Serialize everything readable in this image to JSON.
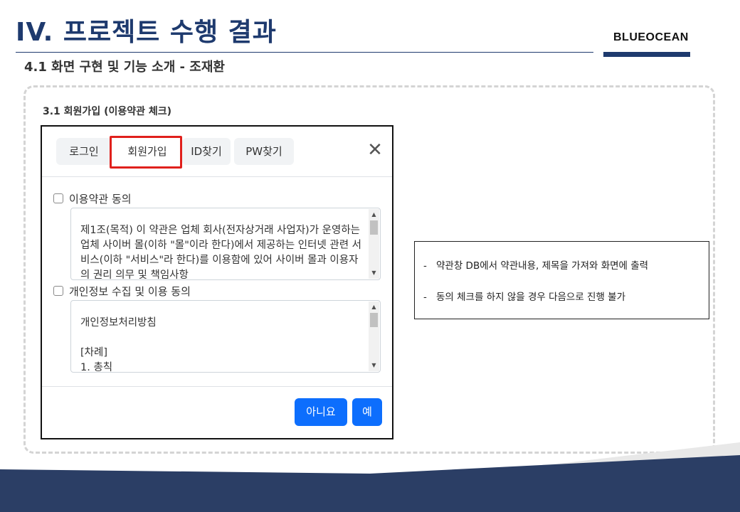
{
  "header": {
    "title": "IV. 프로젝트 수행 결과",
    "brand": "BLUEOCEAN",
    "subtitle": "4.1 화면 구현 및 기능 소개 - 조재환"
  },
  "section": {
    "label": "3.1 회원가입 (이용약관 체크)"
  },
  "modal": {
    "tabs": [
      {
        "label": "로그인"
      },
      {
        "label": "회원가입",
        "highlighted": true
      },
      {
        "label": "ID찾기"
      },
      {
        "label": "PW찾기"
      }
    ],
    "close_symbol": "✕",
    "terms": {
      "label": "이용약관 동의",
      "checked": false,
      "text": "\n제1조(목적) 이 약관은 업체 회사(전자상거래 사업자)가 운영하는 업체 사이버 몰(이하 \"몰\"이라 한다)에서 제공하는 인터넷 관련 서비스(이하 \"서비스\"라 한다)를 이용함에 있어 사이버 몰과 이용자의 권리 의무 및 책임사항"
    },
    "privacy": {
      "label": "개인정보 수집 및 이용 동의",
      "checked": false,
      "text": "\n개인정보처리방침\n\n[차례]\n1. 총칙"
    },
    "buttons": {
      "no": "아니요",
      "yes": "예"
    }
  },
  "description": {
    "items": [
      "약관창 DB에서 약관내용, 제목을 가져와 화면에 출력",
      "동의 체크를 하지 않을 경우 다음으로 진행 불가"
    ]
  },
  "colors": {
    "brand_navy": "#1e3a6e",
    "primary_button": "#0d6efd",
    "highlight_red": "#e0201c"
  }
}
